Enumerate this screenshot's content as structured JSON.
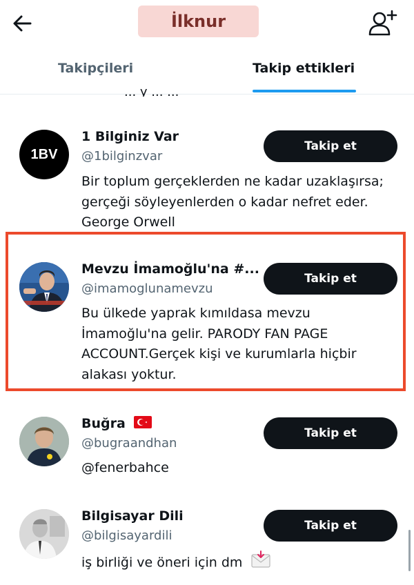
{
  "header": {
    "title": "İlknur",
    "back_icon": "arrow-left-icon",
    "add_user_icon": "person-add-icon"
  },
  "tabs": [
    {
      "label": "Takipçileri",
      "active": false
    },
    {
      "label": "Takip ettikleri",
      "active": true
    }
  ],
  "partial_row_text": "... y    ...   ...",
  "users": [
    {
      "name": "1 Bilginiz Var",
      "handle": "@1bilginzvar",
      "bio": "Bir toplum gerçeklerden ne kadar uzaklaşırsa; gerçeği söyleyenlerden o kadar nefret eder. George Orwell",
      "button": "Takip et",
      "avatar_text": "1BV"
    },
    {
      "name": "Mevzu İmamoğlu'na #...",
      "handle": "@imamoglunamevzu",
      "bio": "Bu ülkede yaprak kımıldasa mevzu İmamoğlu'na gelir. PARODY FAN PAGE ACCOUNT.Gerçek kişi ve kurumlarla hiçbir alakası yoktur.",
      "button": "Takip et",
      "highlighted": true
    },
    {
      "name": "Buğra",
      "handle": "@bugraandhan",
      "bio": "@fenerbahce",
      "button": "Takip et",
      "name_icon": "turkey-flag-icon"
    },
    {
      "name": "Bilgisayar Dili",
      "handle": "@bilgisayardili",
      "bio": "iş birliği ve öneri için dm",
      "button": "Takip et",
      "bio_icon": "envelope-icon"
    }
  ],
  "colors": {
    "highlight": "#ec4a2c",
    "tab_indicator": "#1d9bf0",
    "button_bg": "#0f1419",
    "secondary_text": "#536471"
  }
}
